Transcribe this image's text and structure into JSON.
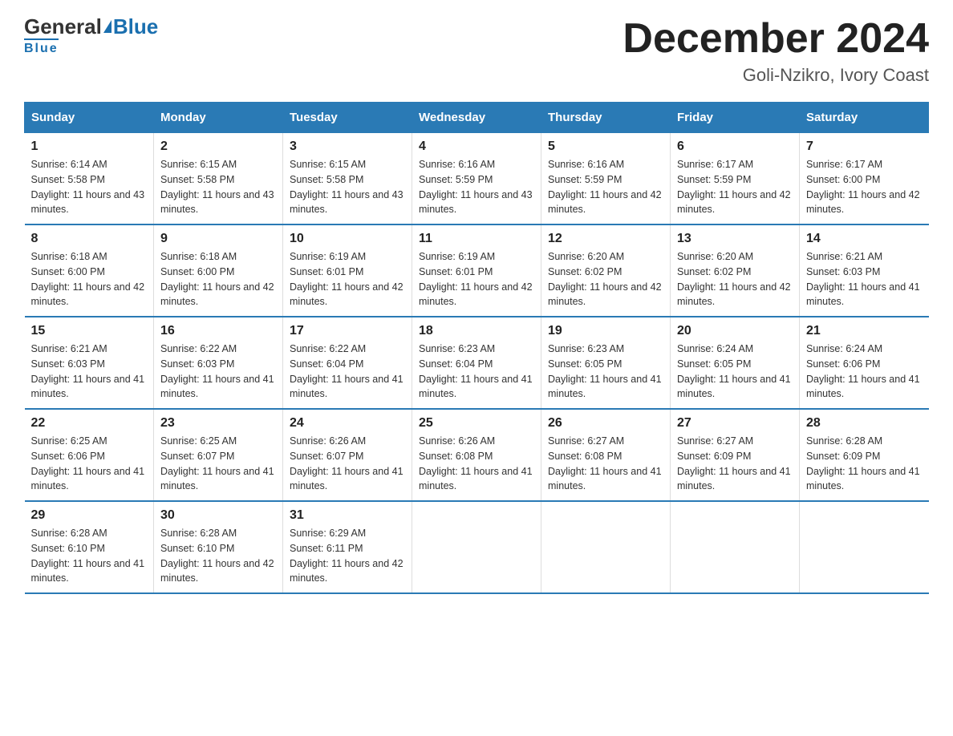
{
  "logo": {
    "general": "General",
    "blue": "Blue"
  },
  "title": "December 2024",
  "location": "Goli-Nzikro, Ivory Coast",
  "days_of_week": [
    "Sunday",
    "Monday",
    "Tuesday",
    "Wednesday",
    "Thursday",
    "Friday",
    "Saturday"
  ],
  "weeks": [
    [
      {
        "day": "1",
        "sunrise": "6:14 AM",
        "sunset": "5:58 PM",
        "daylight": "11 hours and 43 minutes."
      },
      {
        "day": "2",
        "sunrise": "6:15 AM",
        "sunset": "5:58 PM",
        "daylight": "11 hours and 43 minutes."
      },
      {
        "day": "3",
        "sunrise": "6:15 AM",
        "sunset": "5:58 PM",
        "daylight": "11 hours and 43 minutes."
      },
      {
        "day": "4",
        "sunrise": "6:16 AM",
        "sunset": "5:59 PM",
        "daylight": "11 hours and 43 minutes."
      },
      {
        "day": "5",
        "sunrise": "6:16 AM",
        "sunset": "5:59 PM",
        "daylight": "11 hours and 42 minutes."
      },
      {
        "day": "6",
        "sunrise": "6:17 AM",
        "sunset": "5:59 PM",
        "daylight": "11 hours and 42 minutes."
      },
      {
        "day": "7",
        "sunrise": "6:17 AM",
        "sunset": "6:00 PM",
        "daylight": "11 hours and 42 minutes."
      }
    ],
    [
      {
        "day": "8",
        "sunrise": "6:18 AM",
        "sunset": "6:00 PM",
        "daylight": "11 hours and 42 minutes."
      },
      {
        "day": "9",
        "sunrise": "6:18 AM",
        "sunset": "6:00 PM",
        "daylight": "11 hours and 42 minutes."
      },
      {
        "day": "10",
        "sunrise": "6:19 AM",
        "sunset": "6:01 PM",
        "daylight": "11 hours and 42 minutes."
      },
      {
        "day": "11",
        "sunrise": "6:19 AM",
        "sunset": "6:01 PM",
        "daylight": "11 hours and 42 minutes."
      },
      {
        "day": "12",
        "sunrise": "6:20 AM",
        "sunset": "6:02 PM",
        "daylight": "11 hours and 42 minutes."
      },
      {
        "day": "13",
        "sunrise": "6:20 AM",
        "sunset": "6:02 PM",
        "daylight": "11 hours and 42 minutes."
      },
      {
        "day": "14",
        "sunrise": "6:21 AM",
        "sunset": "6:03 PM",
        "daylight": "11 hours and 41 minutes."
      }
    ],
    [
      {
        "day": "15",
        "sunrise": "6:21 AM",
        "sunset": "6:03 PM",
        "daylight": "11 hours and 41 minutes."
      },
      {
        "day": "16",
        "sunrise": "6:22 AM",
        "sunset": "6:03 PM",
        "daylight": "11 hours and 41 minutes."
      },
      {
        "day": "17",
        "sunrise": "6:22 AM",
        "sunset": "6:04 PM",
        "daylight": "11 hours and 41 minutes."
      },
      {
        "day": "18",
        "sunrise": "6:23 AM",
        "sunset": "6:04 PM",
        "daylight": "11 hours and 41 minutes."
      },
      {
        "day": "19",
        "sunrise": "6:23 AM",
        "sunset": "6:05 PM",
        "daylight": "11 hours and 41 minutes."
      },
      {
        "day": "20",
        "sunrise": "6:24 AM",
        "sunset": "6:05 PM",
        "daylight": "11 hours and 41 minutes."
      },
      {
        "day": "21",
        "sunrise": "6:24 AM",
        "sunset": "6:06 PM",
        "daylight": "11 hours and 41 minutes."
      }
    ],
    [
      {
        "day": "22",
        "sunrise": "6:25 AM",
        "sunset": "6:06 PM",
        "daylight": "11 hours and 41 minutes."
      },
      {
        "day": "23",
        "sunrise": "6:25 AM",
        "sunset": "6:07 PM",
        "daylight": "11 hours and 41 minutes."
      },
      {
        "day": "24",
        "sunrise": "6:26 AM",
        "sunset": "6:07 PM",
        "daylight": "11 hours and 41 minutes."
      },
      {
        "day": "25",
        "sunrise": "6:26 AM",
        "sunset": "6:08 PM",
        "daylight": "11 hours and 41 minutes."
      },
      {
        "day": "26",
        "sunrise": "6:27 AM",
        "sunset": "6:08 PM",
        "daylight": "11 hours and 41 minutes."
      },
      {
        "day": "27",
        "sunrise": "6:27 AM",
        "sunset": "6:09 PM",
        "daylight": "11 hours and 41 minutes."
      },
      {
        "day": "28",
        "sunrise": "6:28 AM",
        "sunset": "6:09 PM",
        "daylight": "11 hours and 41 minutes."
      }
    ],
    [
      {
        "day": "29",
        "sunrise": "6:28 AM",
        "sunset": "6:10 PM",
        "daylight": "11 hours and 41 minutes."
      },
      {
        "day": "30",
        "sunrise": "6:28 AM",
        "sunset": "6:10 PM",
        "daylight": "11 hours and 42 minutes."
      },
      {
        "day": "31",
        "sunrise": "6:29 AM",
        "sunset": "6:11 PM",
        "daylight": "11 hours and 42 minutes."
      },
      null,
      null,
      null,
      null
    ]
  ]
}
